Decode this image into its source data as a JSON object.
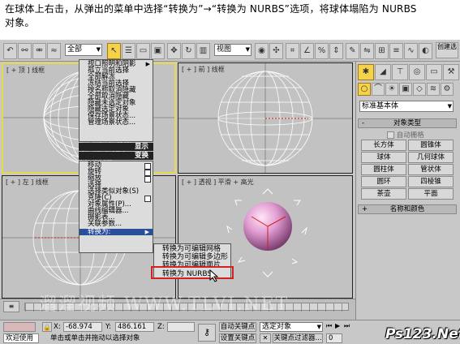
{
  "instruction": {
    "line1": "在球体上右击，从弹出的菜单中选择“转换为”→“转换为 NURBS”选项，将球体塌陷为 NURBS",
    "line2": "对象。"
  },
  "toolbar": {
    "selection_filter": "全部",
    "view_ref": "视图",
    "create_selection": "创建选"
  },
  "viewports": [
    {
      "label": "[ + 顶 ] 线框",
      "name": "top"
    },
    {
      "label": "[ + ] 前 ] 线框",
      "name": "front"
    },
    {
      "label": "[ + ] 左 ] 线框",
      "name": "left"
    },
    {
      "label": "[ + ] 透视 ] 平滑 + 高光",
      "name": "perspective"
    }
  ],
  "quad_menu": {
    "display_items": [
      "视口照明和阴影",
      "孤立当前选择",
      "全部解冻",
      "冻结当前选择",
      "按名称取消隐藏",
      "全部取消隐藏",
      "隐藏未选定对象",
      "隐藏选定对象",
      "保存场景状态...",
      "管理场景状态..."
    ],
    "display_header": "显示",
    "transform_header": "变换",
    "transform_items": [
      "移动",
      "旋转",
      "缩放",
      "选择",
      "选择类似对象(S)",
      "克隆(C)",
      "对象属性(P)...",
      "曲线编辑器...",
      "摄影表...",
      "关联参数...",
      "转换为:"
    ],
    "convert_submenu": [
      "转换为可编辑网格",
      "转换为可编辑多边形",
      "转换为可编辑面片",
      "转换为 NURBS"
    ]
  },
  "command_panel": {
    "category": "标准基本体",
    "rollout_object_type": "对象类型",
    "autogrid": "自动栅格",
    "buttons": [
      [
        "长方体",
        "圆锥体"
      ],
      [
        "球体",
        "几何球体"
      ],
      [
        "圆柱体",
        "管状体"
      ],
      [
        "圆环",
        "四棱锥"
      ],
      [
        "茶壶",
        "平面"
      ]
    ],
    "rollout_name_color": "名称和颜色"
  },
  "status": {
    "x_label": "X:",
    "x_value": "-68.974",
    "y_label": "Y:",
    "y_value": "486.161",
    "z_label": "Z:",
    "z_value": "",
    "autokey": "自动关键点",
    "setkey": "设置关键点",
    "selected_object": "选定对象",
    "keyfilter": "关键点过滤器...",
    "welcome": "欢迎使用",
    "prompt": "单击或单击并拖动以选择对象",
    "frame_value": "0"
  },
  "watermark": "溜溜视频 WWW.TLVI.NET",
  "site_logo": "Ps123.Net"
}
